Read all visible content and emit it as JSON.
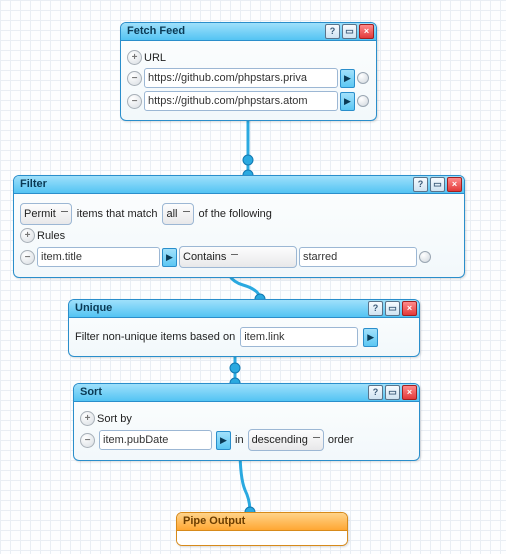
{
  "modules": {
    "fetch": {
      "title": "Fetch Feed",
      "url_label": "URL",
      "urls": [
        "https://github.com/phpstars.priva",
        "https://github.com/phpstars.atom"
      ]
    },
    "filter": {
      "title": "Filter",
      "mode": "Permit",
      "text1": "items that match",
      "scope": "all",
      "text2": "of the following",
      "rules_label": "Rules",
      "rule_field": "item.title",
      "rule_op": "Contains",
      "rule_value": "starred"
    },
    "unique": {
      "title": "Unique",
      "text": "Filter non-unique items based on",
      "field": "item.link"
    },
    "sort": {
      "title": "Sort",
      "label": "Sort by",
      "field": "item.pubDate",
      "text_in": "in",
      "dir": "descending",
      "text_order": "order"
    }
  },
  "output_label": "Pipe Output"
}
